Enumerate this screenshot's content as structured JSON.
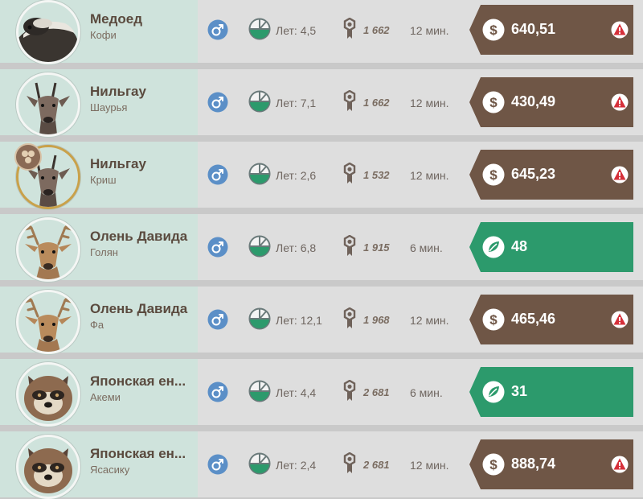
{
  "rows": [
    {
      "species": "Медоед",
      "name": "Кофи",
      "age": "Лет: 4,5",
      "score": "1 662",
      "time": "12 мин.",
      "price": "640,51",
      "price_type": "sell",
      "alert": true,
      "animal": "honey-badger",
      "tag": false
    },
    {
      "species": "Нильгау",
      "name": "Шаурья",
      "age": "Лет: 7,1",
      "score": "1 662",
      "time": "12 мин.",
      "price": "430,49",
      "price_type": "sell",
      "alert": true,
      "animal": "nilgai",
      "tag": false
    },
    {
      "species": "Нильгау",
      "name": "Криш",
      "age": "Лет: 2,6",
      "score": "1 532",
      "time": "12 мин.",
      "price": "645,23",
      "price_type": "sell",
      "alert": true,
      "animal": "nilgai",
      "tag": true
    },
    {
      "species": "Олень Давида",
      "name": "Голян",
      "age": "Лет: 6,8",
      "score": "1 915",
      "time": "6 мин.",
      "price": "48",
      "price_type": "food",
      "alert": false,
      "animal": "deer",
      "tag": false
    },
    {
      "species": "Олень Давида",
      "name": "Фа",
      "age": "Лет: 12,1",
      "score": "1 968",
      "time": "12 мин.",
      "price": "465,46",
      "price_type": "sell",
      "alert": true,
      "animal": "deer",
      "tag": false
    },
    {
      "species": "Японская ен...",
      "name": "Акеми",
      "age": "Лет: 4,4",
      "score": "2 681",
      "time": "6 мин.",
      "price": "31",
      "price_type": "food",
      "alert": false,
      "animal": "raccoon-dog",
      "tag": false
    },
    {
      "species": "Японская ен...",
      "name": "Ясасику",
      "age": "Лет: 2,4",
      "score": "2 681",
      "time": "12 мин.",
      "price": "888,74",
      "price_type": "sell",
      "alert": true,
      "animal": "raccoon-dog",
      "tag": false
    }
  ]
}
